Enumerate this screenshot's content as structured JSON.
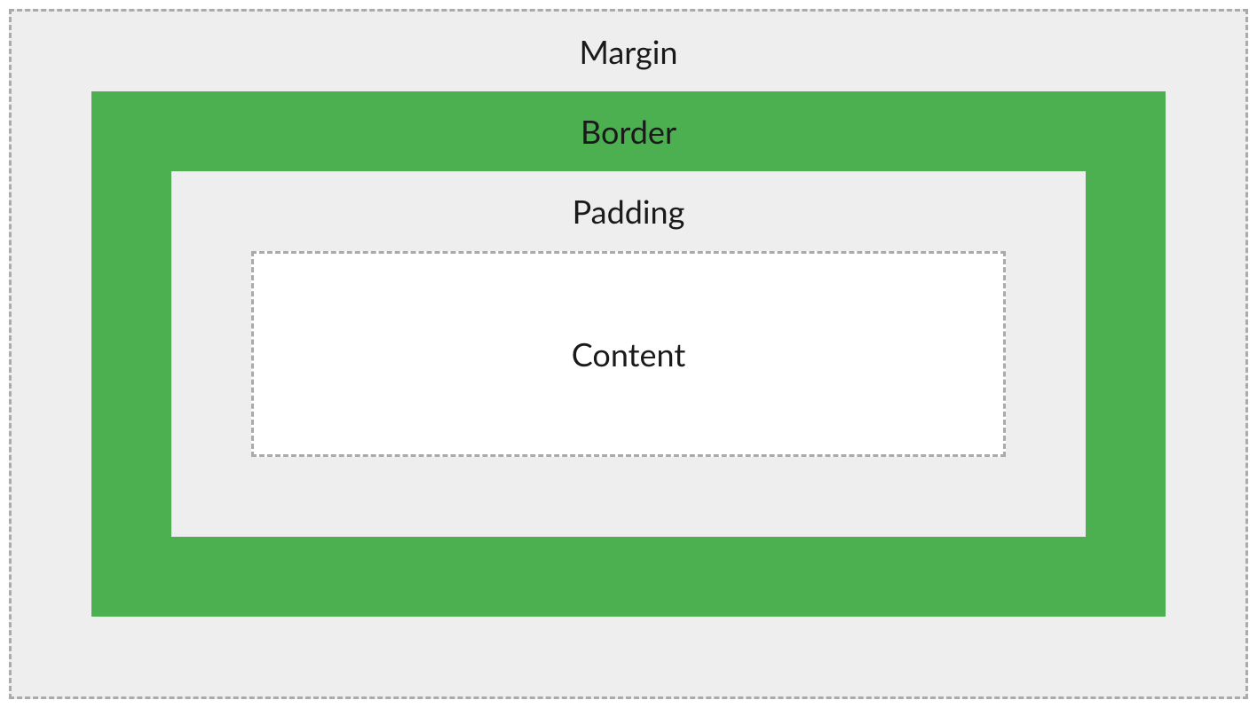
{
  "boxModel": {
    "margin": {
      "label": "Margin",
      "background": "#eeeeee",
      "borderStyle": "dashed",
      "borderColor": "#aaaaaa"
    },
    "border": {
      "label": "Border",
      "background": "#4caf50"
    },
    "padding": {
      "label": "Padding",
      "background": "#eeeeee"
    },
    "content": {
      "label": "Content",
      "background": "#ffffff",
      "borderStyle": "dashed",
      "borderColor": "#aaaaaa"
    }
  }
}
